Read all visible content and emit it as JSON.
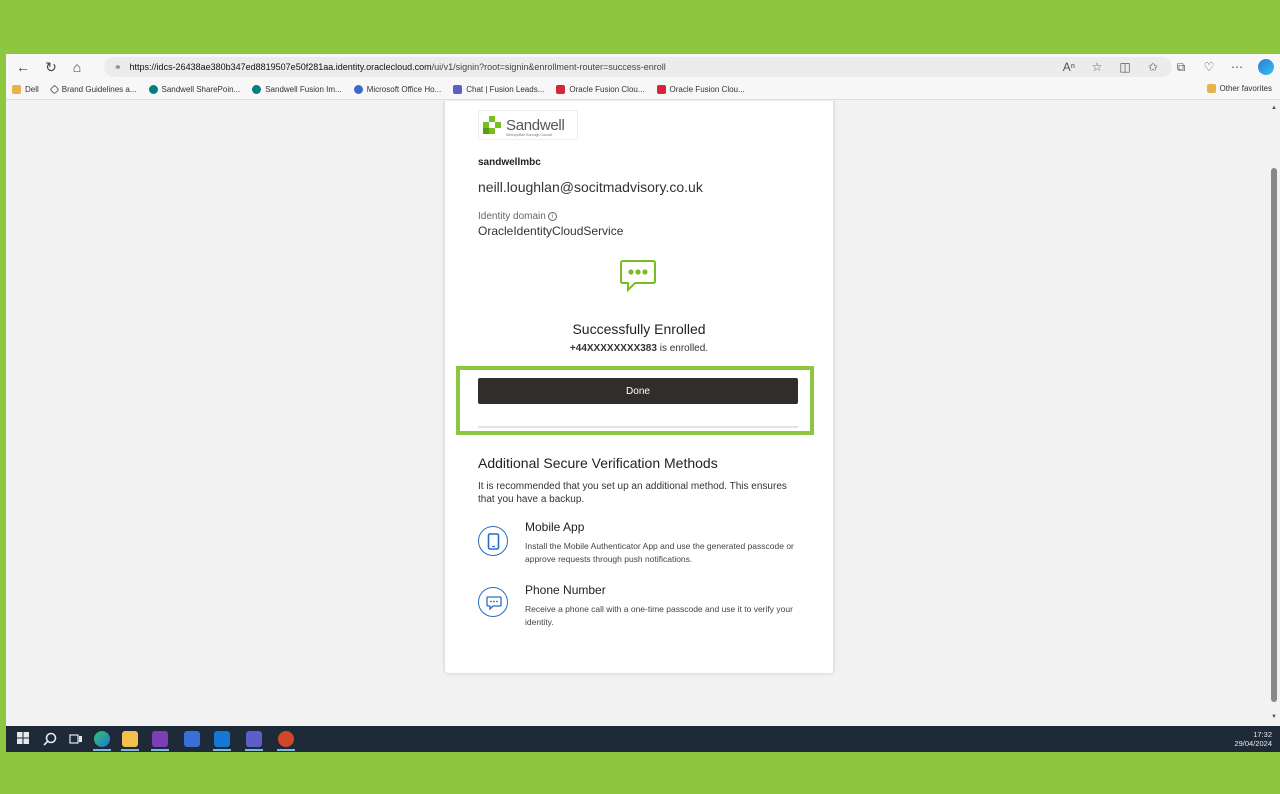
{
  "browser": {
    "url_host": "https://idcs-26438ae380b347ed8819507e50f281aa.identity.oraclecloud.com",
    "url_path": "/ui/v1/signin?root=signin&enrollment-router=success-enroll"
  },
  "favorites": [
    {
      "label": "Dell",
      "icon": "folder-icon"
    },
    {
      "label": "Brand Guidelines a...",
      "icon": "brand-icon"
    },
    {
      "label": "Sandwell SharePoin...",
      "icon": "sharepoint-icon"
    },
    {
      "label": "Sandwell Fusion Im...",
      "icon": "sharepoint-icon"
    },
    {
      "label": "Microsoft Office Ho...",
      "icon": "office-icon"
    },
    {
      "label": "Chat | Fusion Leads...",
      "icon": "teams-icon"
    },
    {
      "label": "Oracle Fusion Clou...",
      "icon": "oracle-icon"
    },
    {
      "label": "Oracle Fusion Clou...",
      "icon": "oracle-icon"
    }
  ],
  "other_favorites": "Other favorites",
  "card": {
    "logo_text": "Sandwell",
    "logo_sub": "Metropolitan Borough Council",
    "tenant": "sandwellmbc",
    "username": "neill.loughlan@socitmadvisory.co.uk",
    "identity_domain_label": "Identity domain",
    "identity_domain_value": "OracleIdentityCloudService",
    "success_title": "Successfully Enrolled",
    "enrolled_number": "+44XXXXXXXX383",
    "enrolled_suffix": " is enrolled.",
    "done_label": "Done",
    "additional_title": "Additional Secure Verification Methods",
    "additional_desc": "It is recommended that you set up an additional method. This ensures that you have a backup.",
    "methods": [
      {
        "title": "Mobile App",
        "desc": "Install the Mobile Authenticator App and use the generated passcode or approve requests through push notifications.",
        "icon": "mobile-phone-icon"
      },
      {
        "title": "Phone Number",
        "desc": "Receive a phone call with a one-time passcode and use it to verify your identity.",
        "icon": "chat-bubble-icon"
      }
    ]
  },
  "clock": {
    "time": "17:32",
    "date": "29/04/2024"
  },
  "colors": {
    "highlight": "#8dc63f",
    "button": "#312d2a",
    "accent_green": "#78be20",
    "icon_blue": "#2b6cc4"
  }
}
